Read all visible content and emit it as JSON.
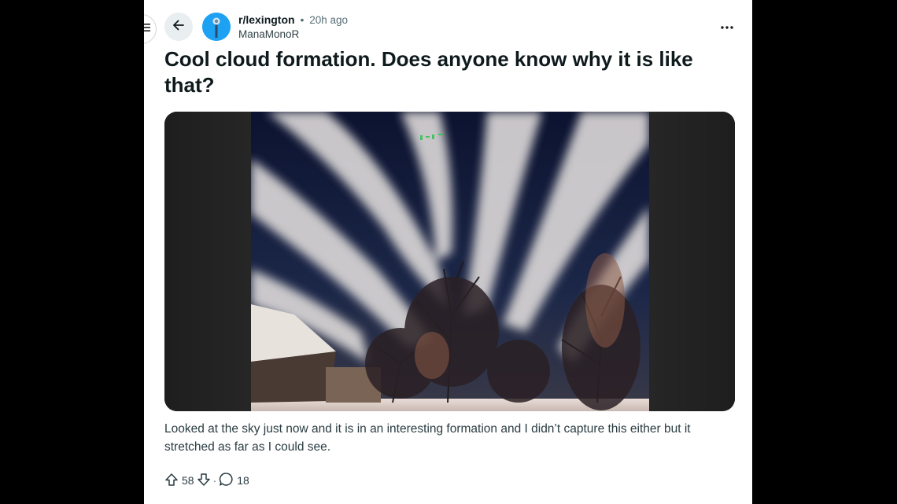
{
  "post": {
    "subreddit": "r/lexington",
    "separator": "•",
    "time_ago": "20h ago",
    "author": "ManaMonoR",
    "title": "Cool cloud formation. Does anyone know why it is like that?",
    "body": "Looked at the sky just now and it is in an interesting formation and I didn’t capture this either but it stretched as far as I could see.",
    "upvotes": "58",
    "vote_separator": "·",
    "comments": "18"
  },
  "icons": {
    "menu": "menu-icon",
    "back": "arrow-left-icon",
    "avatar": "community-avatar",
    "more": "ellipsis-icon",
    "upvote": "arrow-up-icon",
    "downvote": "arrow-down-icon",
    "comment": "comment-bubble-icon"
  },
  "colors": {
    "backdrop": "#000000",
    "panel": "#ffffff",
    "avatar_bg": "#1da1f2",
    "title_text": "#0f1a1c",
    "meta_text": "#576f76"
  }
}
